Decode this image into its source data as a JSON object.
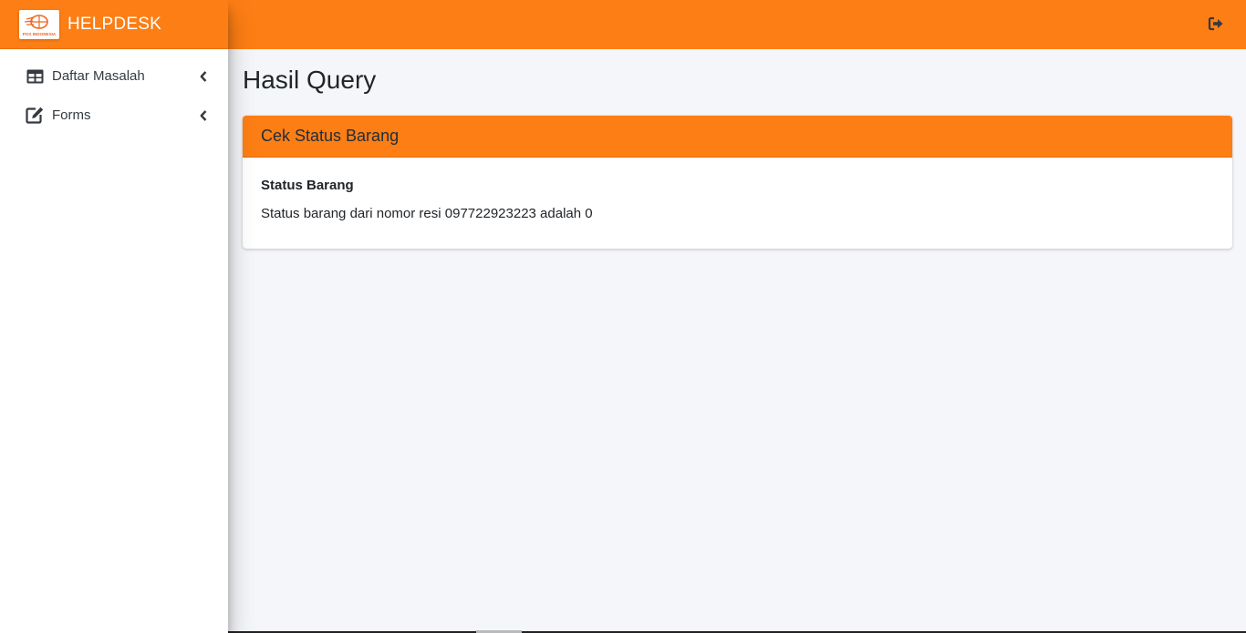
{
  "brand": {
    "name": "HELPDESK",
    "logo_text": "POS INDONESIA",
    "accent_color": "#fd7e14"
  },
  "sidebar": {
    "items": [
      {
        "label": "Daftar Masalah",
        "icon": "table-icon"
      },
      {
        "label": "Forms",
        "icon": "edit-icon"
      }
    ]
  },
  "topbar": {
    "logout_icon": "sign-out-icon"
  },
  "main": {
    "page_title": "Hasil Query",
    "card": {
      "header": "Cek Status Barang",
      "subtitle": "Status Barang",
      "text": "Status barang dari nomor resi 097722923223 adalah 0"
    }
  }
}
